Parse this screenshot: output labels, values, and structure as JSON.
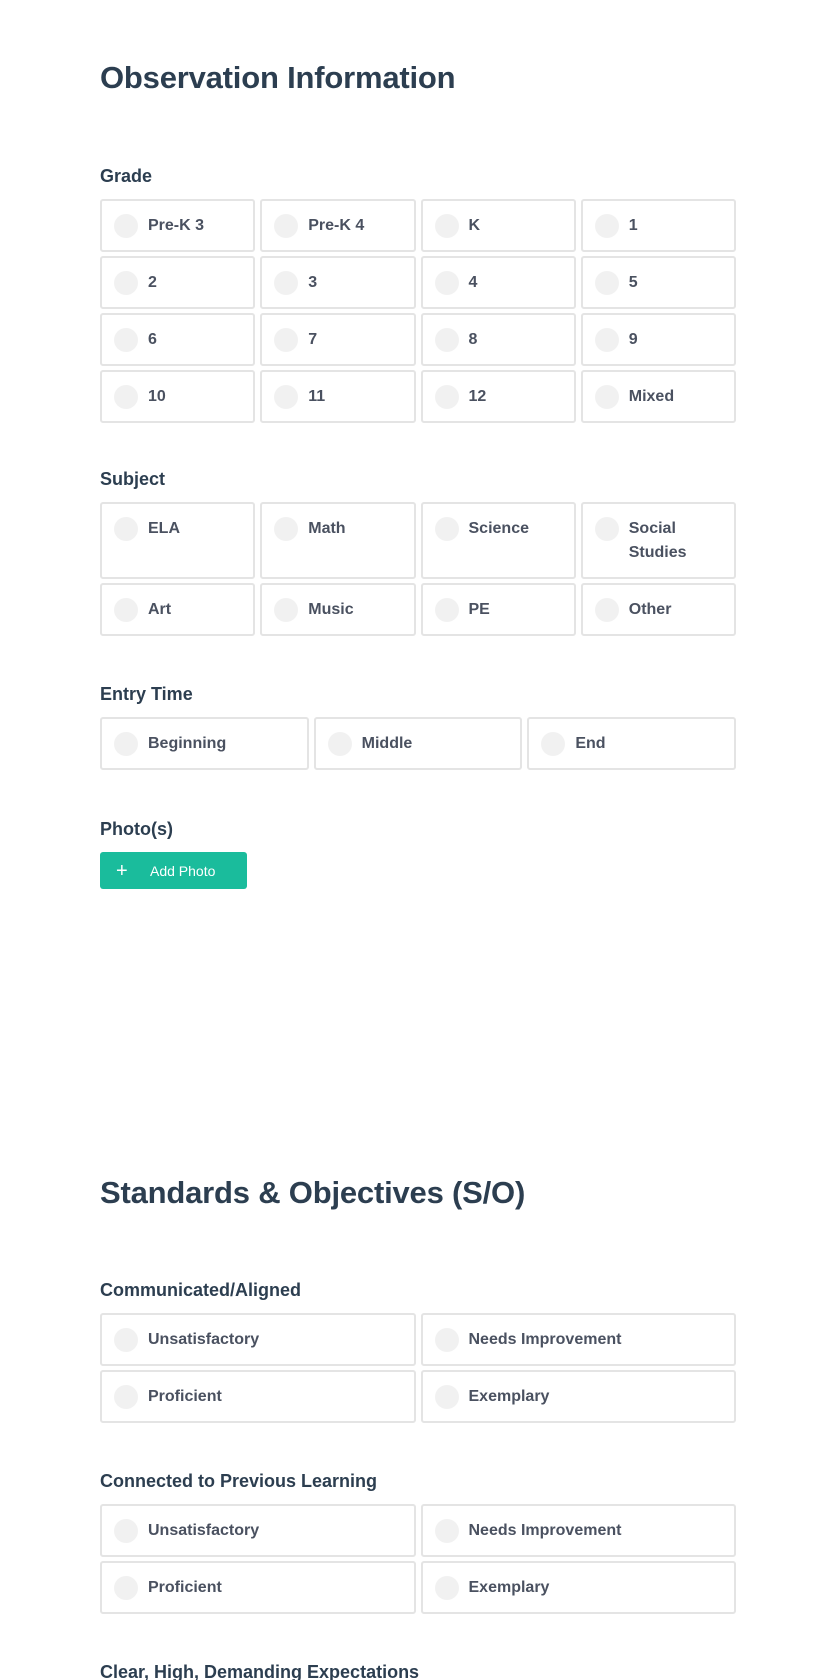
{
  "observation": {
    "title": "Observation Information",
    "grade": {
      "label": "Grade",
      "options": [
        "Pre-K 3",
        "Pre-K 4",
        "K",
        "1",
        "2",
        "3",
        "4",
        "5",
        "6",
        "7",
        "8",
        "9",
        "10",
        "11",
        "12",
        "Mixed"
      ]
    },
    "subject": {
      "label": "Subject",
      "options": [
        "ELA",
        "Math",
        "Science",
        "Social Studies",
        "Art",
        "Music",
        "PE",
        "Other"
      ]
    },
    "entry_time": {
      "label": "Entry Time",
      "options": [
        "Beginning",
        "Middle",
        "End"
      ]
    },
    "photos": {
      "label": "Photo(s)",
      "add_button": "Add Photo",
      "add_icon": "plus-icon"
    }
  },
  "standards": {
    "title": "Standards & Objectives (S/O)",
    "communicated": {
      "label": "Communicated/Aligned",
      "options": [
        "Unsatisfactory",
        "Needs Improvement",
        "Proficient",
        "Exemplary"
      ]
    },
    "connected": {
      "label": "Connected to Previous Learning",
      "options": [
        "Unsatisfactory",
        "Needs Improvement",
        "Proficient",
        "Exemplary"
      ]
    },
    "expectations": {
      "label": "Clear, High, Demanding Expectations"
    }
  }
}
